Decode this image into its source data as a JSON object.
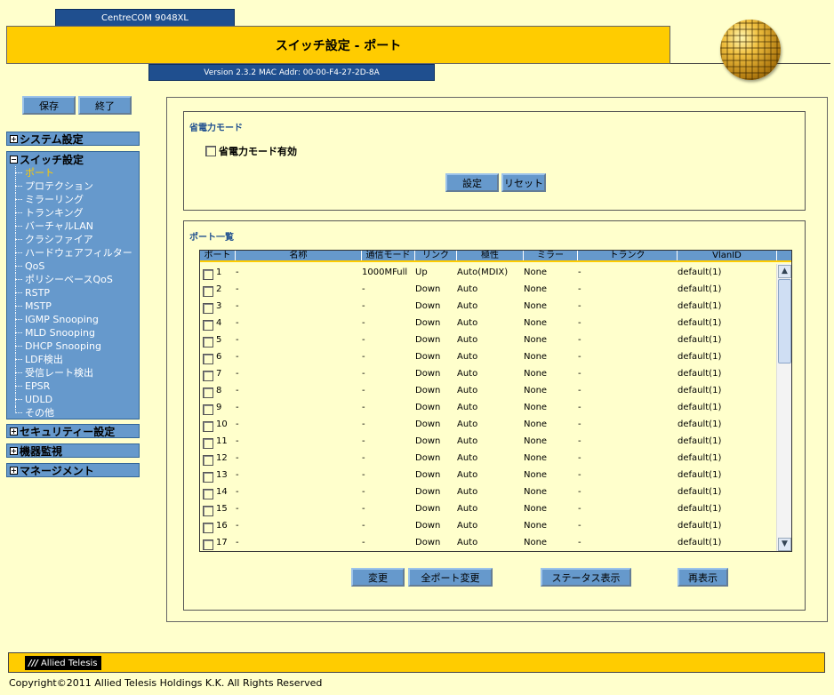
{
  "header": {
    "model": "CentreCOM 9048XL",
    "title": "スイッチ設定 - ポート",
    "version": "Version 2.3.2 MAC Addr: 00-00-F4-27-2D-8A"
  },
  "toolbar": {
    "save_label": "保存",
    "exit_label": "終了"
  },
  "sidebar": {
    "system": "システム設定",
    "switch": "スイッチ設定",
    "switch_items": [
      "ポート",
      "プロテクション",
      "ミラーリング",
      "トランキング",
      "バーチャルLAN",
      "クラシファイア",
      "ハードウェアフィルター",
      "QoS",
      "ポリシーベースQoS",
      "RSTP",
      "MSTP",
      "IGMP Snooping",
      "MLD Snooping",
      "DHCP Snooping",
      "LDF検出",
      "受信レート検出",
      "EPSR",
      "UDLD",
      "その他"
    ],
    "security": "セキュリティー設定",
    "monitor": "機器監視",
    "management": "マネージメント",
    "plus": "+",
    "minus": "−"
  },
  "eco": {
    "title": "省電力モード",
    "checkbox_label": "省電力モード有効",
    "set_label": "設定",
    "reset_label": "リセット"
  },
  "ports": {
    "title": "ポート一覧",
    "headers": [
      "ポート",
      "名称",
      "通信モード",
      "リンク",
      "極性",
      "ミラー",
      "トランク",
      "VlanID"
    ],
    "rows": [
      {
        "port": "1",
        "name": "-",
        "mode": "1000MFull",
        "link": "Up",
        "polarity": "Auto(MDIX)",
        "mirror": "None",
        "trunk": "-",
        "vlan": "default(1)"
      },
      {
        "port": "2",
        "name": "-",
        "mode": "-",
        "link": "Down",
        "polarity": "Auto",
        "mirror": "None",
        "trunk": "-",
        "vlan": "default(1)"
      },
      {
        "port": "3",
        "name": "-",
        "mode": "-",
        "link": "Down",
        "polarity": "Auto",
        "mirror": "None",
        "trunk": "-",
        "vlan": "default(1)"
      },
      {
        "port": "4",
        "name": "-",
        "mode": "-",
        "link": "Down",
        "polarity": "Auto",
        "mirror": "None",
        "trunk": "-",
        "vlan": "default(1)"
      },
      {
        "port": "5",
        "name": "-",
        "mode": "-",
        "link": "Down",
        "polarity": "Auto",
        "mirror": "None",
        "trunk": "-",
        "vlan": "default(1)"
      },
      {
        "port": "6",
        "name": "-",
        "mode": "-",
        "link": "Down",
        "polarity": "Auto",
        "mirror": "None",
        "trunk": "-",
        "vlan": "default(1)"
      },
      {
        "port": "7",
        "name": "-",
        "mode": "-",
        "link": "Down",
        "polarity": "Auto",
        "mirror": "None",
        "trunk": "-",
        "vlan": "default(1)"
      },
      {
        "port": "8",
        "name": "-",
        "mode": "-",
        "link": "Down",
        "polarity": "Auto",
        "mirror": "None",
        "trunk": "-",
        "vlan": "default(1)"
      },
      {
        "port": "9",
        "name": "-",
        "mode": "-",
        "link": "Down",
        "polarity": "Auto",
        "mirror": "None",
        "trunk": "-",
        "vlan": "default(1)"
      },
      {
        "port": "10",
        "name": "-",
        "mode": "-",
        "link": "Down",
        "polarity": "Auto",
        "mirror": "None",
        "trunk": "-",
        "vlan": "default(1)"
      },
      {
        "port": "11",
        "name": "-",
        "mode": "-",
        "link": "Down",
        "polarity": "Auto",
        "mirror": "None",
        "trunk": "-",
        "vlan": "default(1)"
      },
      {
        "port": "12",
        "name": "-",
        "mode": "-",
        "link": "Down",
        "polarity": "Auto",
        "mirror": "None",
        "trunk": "-",
        "vlan": "default(1)"
      },
      {
        "port": "13",
        "name": "-",
        "mode": "-",
        "link": "Down",
        "polarity": "Auto",
        "mirror": "None",
        "trunk": "-",
        "vlan": "default(1)"
      },
      {
        "port": "14",
        "name": "-",
        "mode": "-",
        "link": "Down",
        "polarity": "Auto",
        "mirror": "None",
        "trunk": "-",
        "vlan": "default(1)"
      },
      {
        "port": "15",
        "name": "-",
        "mode": "-",
        "link": "Down",
        "polarity": "Auto",
        "mirror": "None",
        "trunk": "-",
        "vlan": "default(1)"
      },
      {
        "port": "16",
        "name": "-",
        "mode": "-",
        "link": "Down",
        "polarity": "Auto",
        "mirror": "None",
        "trunk": "-",
        "vlan": "default(1)"
      },
      {
        "port": "17",
        "name": "-",
        "mode": "-",
        "link": "Down",
        "polarity": "Auto",
        "mirror": "None",
        "trunk": "-",
        "vlan": "default(1)"
      }
    ],
    "change_label": "変更",
    "all_change_label": "全ポート変更",
    "status_label": "ステータス表示",
    "refresh_label": "再表示"
  },
  "footer": {
    "logo": "Allied Telesis",
    "copyright": "Copyright©2011 Allied Telesis Holdings K.K. All Rights Reserved"
  }
}
